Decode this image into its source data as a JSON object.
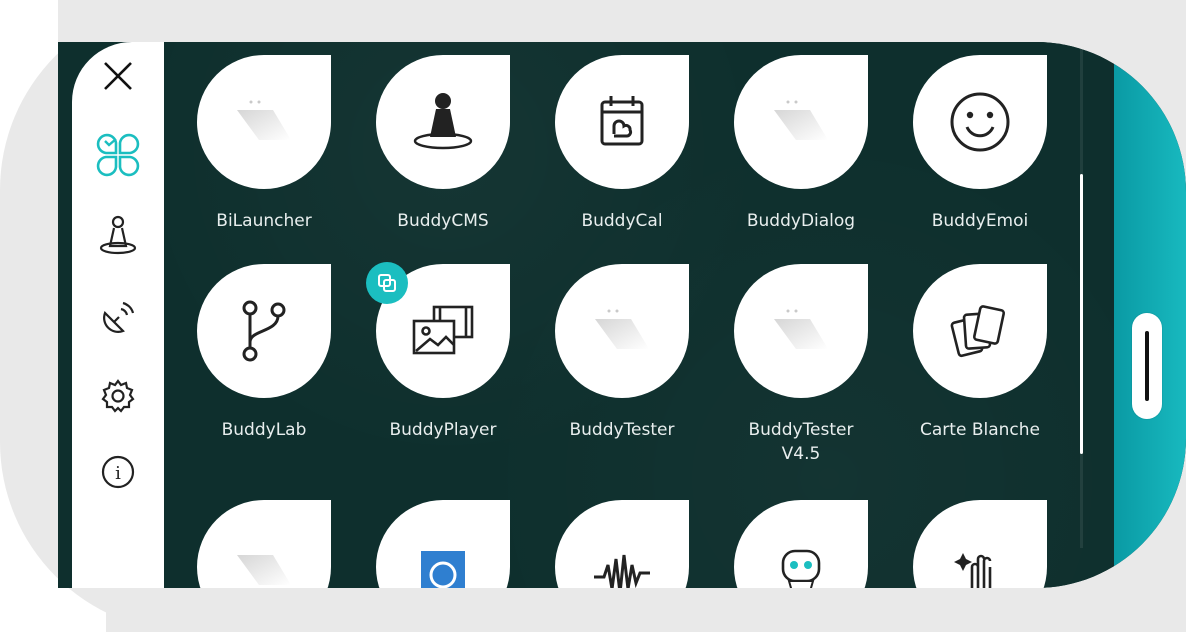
{
  "sidebar": {
    "close_label": "close",
    "items": [
      {
        "icon": "x-close-icon"
      },
      {
        "icon": "apps-grid-icon",
        "active_color": "#1bbec0"
      },
      {
        "icon": "robot-buddy-icon"
      },
      {
        "icon": "satellite-signal-icon"
      },
      {
        "icon": "gear-icon"
      },
      {
        "icon": "info-icon"
      }
    ]
  },
  "apps": [
    {
      "label": "BiLauncher",
      "icon": "placeholder-icon"
    },
    {
      "label": "BuddyCMS",
      "icon": "robot-buddy-icon"
    },
    {
      "label": "BuddyCal",
      "icon": "calendar-icon"
    },
    {
      "label": "BuddyDialog",
      "icon": "placeholder-icon"
    },
    {
      "label": "BuddyEmoi",
      "icon": "smiley-icon"
    },
    {
      "label": "BuddyLab",
      "icon": "branch-icon"
    },
    {
      "label": "BuddyPlayer",
      "icon": "media-gallery-icon",
      "badge": "copy-icon"
    },
    {
      "label": "BuddyTester",
      "icon": "placeholder-icon"
    },
    {
      "label": "BuddyTester\nV4.5",
      "icon": "placeholder-icon"
    },
    {
      "label": "Carte Blanche",
      "icon": "cards-icon"
    },
    {
      "label": "",
      "icon": "placeholder-icon"
    },
    {
      "label": "",
      "icon": "blue-folder-icon"
    },
    {
      "label": "",
      "icon": "waveform-icon"
    },
    {
      "label": "",
      "icon": "robot-face-icon"
    },
    {
      "label": "",
      "icon": "hand-sparkle-icon"
    }
  ],
  "colors": {
    "background": "#0e2f2d",
    "accent": "#1bbec0",
    "strip": "#18b9bf"
  }
}
